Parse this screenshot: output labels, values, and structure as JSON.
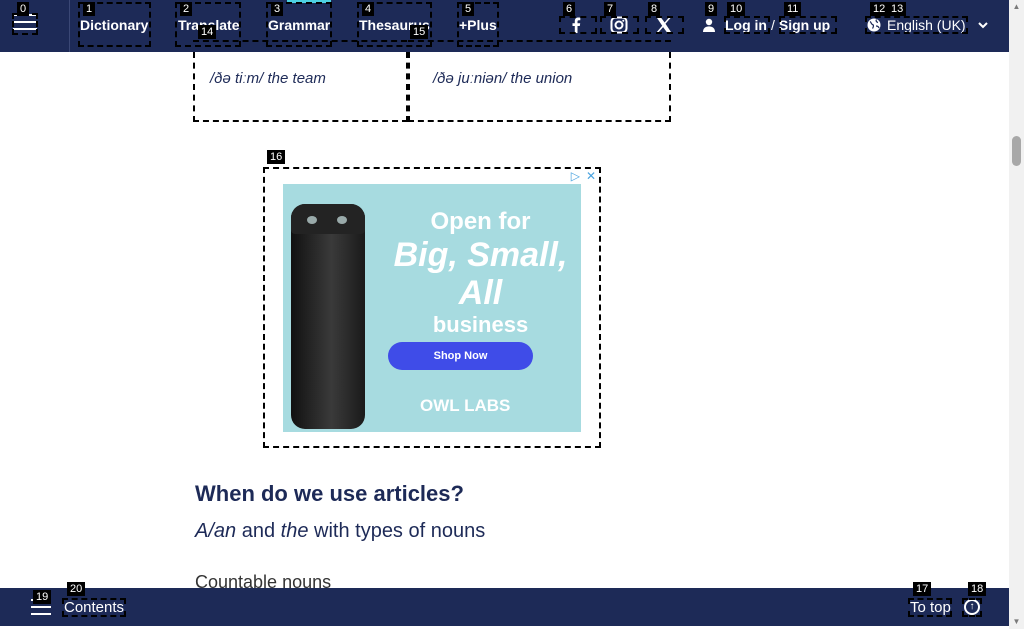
{
  "topnav": {
    "items": [
      {
        "label": "Dictionary"
      },
      {
        "label": "Translate"
      },
      {
        "label": "Grammar"
      },
      {
        "label": "Thesaurus"
      },
      {
        "label": "+Plus"
      }
    ],
    "social": [
      "facebook-icon",
      "instagram-icon",
      "x-icon"
    ],
    "login_label": "Log in",
    "separator": "/",
    "signup_label": "Sign up",
    "language_label": "English (UK)"
  },
  "table": {
    "cells": [
      {
        "text": "/ðə tiːm/ the team"
      },
      {
        "text": "/ðə juːniən/ the union"
      }
    ]
  },
  "ad": {
    "line1": "Open for",
    "line2": "Big, Small, All",
    "line3": "business",
    "cta": "Shop Now",
    "brand": "OWL LABS"
  },
  "content": {
    "heading": "When do we use articles?",
    "sub_a": "A/an",
    "sub_and": " and ",
    "sub_the": "the",
    "sub_rest": " with types of nouns",
    "body": "Countable nouns"
  },
  "bottombar": {
    "contents_label": "Contents",
    "totop_label": "To top"
  },
  "annotations": [
    "0",
    "1",
    "2",
    "3",
    "4",
    "5",
    "6",
    "7",
    "8",
    "9",
    "10",
    "11",
    "12",
    "13",
    "14",
    "15",
    "16",
    "17",
    "18",
    "19",
    "20"
  ],
  "colors": {
    "navy": "#1d2a57",
    "accent": "#4dd0e1",
    "ad_bg": "#a7dbe0",
    "cta": "#3f4ce8"
  }
}
